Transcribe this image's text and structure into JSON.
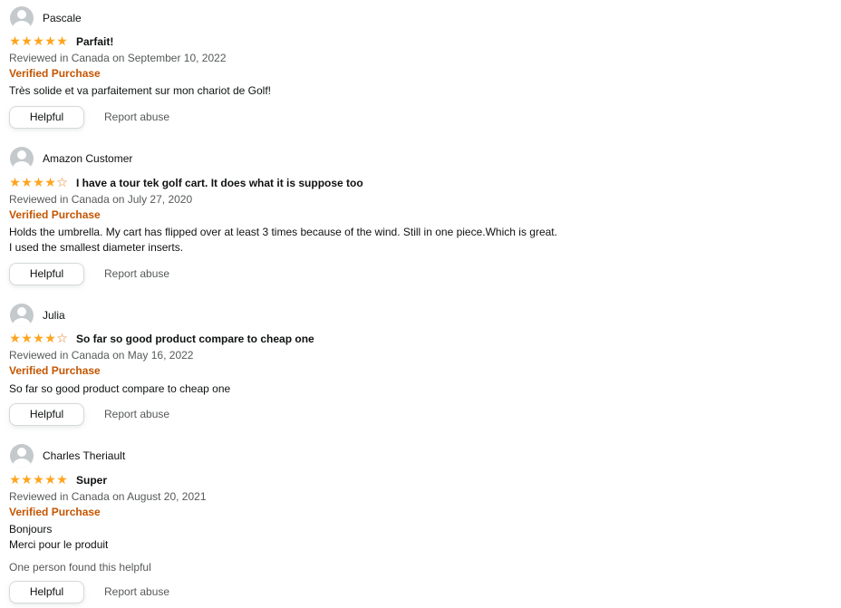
{
  "colors": {
    "star": "#ffa41c",
    "verified": "#c45500",
    "secondary_text": "#565959",
    "primary_text": "#0f1111",
    "button_border": "#d5d9d9"
  },
  "reviews": [
    {
      "author": "Pascale",
      "rating": 5,
      "stars": "★★★★★",
      "title": "Parfait!",
      "date": "Reviewed in Canada on September 10, 2022",
      "verified": "Verified Purchase",
      "body_lines": [
        "Très solide et va parfaitement sur mon chariot de Golf!"
      ],
      "helpful_count": "",
      "helpful_label": "Helpful",
      "report_label": "Report abuse"
    },
    {
      "author": "Amazon Customer",
      "rating": 4,
      "stars": "★★★★☆",
      "title": "I have a tour tek golf cart. It does what it is suppose too",
      "date": "Reviewed in Canada on July 27, 2020",
      "verified": "Verified Purchase",
      "body_lines": [
        "Holds the umbrella. My cart has flipped over at least 3 times because of the wind. Still in one piece.Which is great.",
        "I used the smallest diameter inserts."
      ],
      "helpful_count": "",
      "helpful_label": "Helpful",
      "report_label": "Report abuse"
    },
    {
      "author": "Julia",
      "rating": 4,
      "stars": "★★★★☆",
      "title": "So far so good product compare to cheap one",
      "date": "Reviewed in Canada on May 16, 2022",
      "verified": "Verified Purchase",
      "body_lines": [
        "So far so good product compare to cheap one"
      ],
      "helpful_count": "",
      "helpful_label": "Helpful",
      "report_label": "Report abuse"
    },
    {
      "author": "Charles Theriault",
      "rating": 5,
      "stars": "★★★★★",
      "title": "Super",
      "date": "Reviewed in Canada on August 20, 2021",
      "verified": "Verified Purchase",
      "body_lines": [
        "Bonjours",
        "Merci pour le produit"
      ],
      "helpful_count": "One person found this helpful",
      "helpful_label": "Helpful",
      "report_label": "Report abuse"
    }
  ]
}
